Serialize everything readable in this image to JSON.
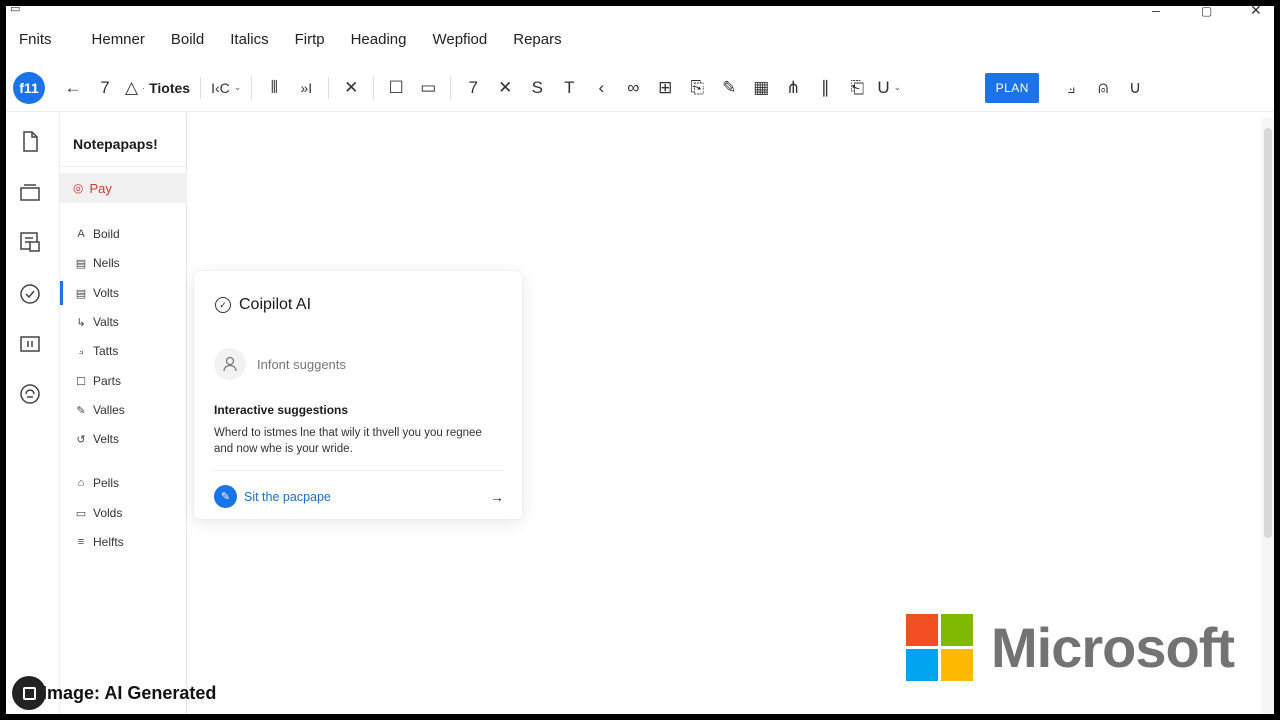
{
  "menu": [
    "Fnits",
    "Hemner",
    "Boild",
    "Italics",
    "Firtp",
    "Heading",
    "Wepfiod",
    "Repars"
  ],
  "toolbar": {
    "avatar": "f11",
    "font_label": "Tiotes",
    "size_label": "I‹C",
    "plan_label": "PLAN"
  },
  "sidebar": {
    "title": "Notepapaps!",
    "active": "Pay",
    "items": [
      "Boild",
      "Nells",
      "Volts",
      "Valts",
      "Tatts",
      "Parts",
      "Valles",
      "Velts",
      "Pells",
      "Volds",
      "Helfts"
    ]
  },
  "copilot": {
    "title": "Coipilot AI",
    "suggest": "Infont suggents",
    "heading": "Interactive suggestions",
    "body": "Wherd to istmes lne that wily it thvell you you regnee and now whe is your wride.",
    "action": "Sit the pacpape"
  },
  "logo": {
    "word": "Microsoft"
  },
  "watermark": "Image: AI Generated",
  "colors": {
    "accent": "#1a73e8",
    "active_item": "#d23b2b",
    "ms_red": "#f25022",
    "ms_green": "#7fba00",
    "ms_blue": "#00a4ef",
    "ms_yellow": "#ffb900"
  }
}
